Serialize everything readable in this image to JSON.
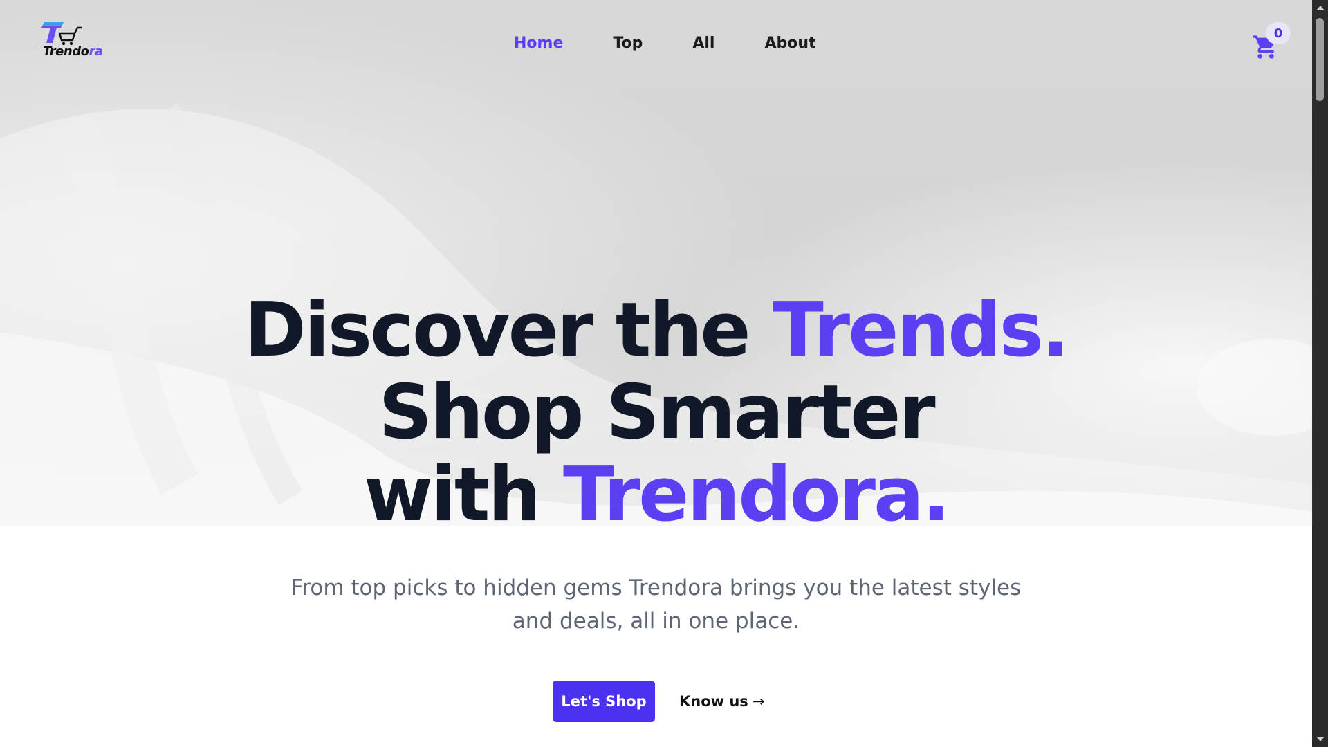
{
  "brand": {
    "logo_text": "Trendo",
    "logo_accent_text": "ra",
    "accent_color": "#5b3ff2",
    "text_color": "#111827"
  },
  "nav": {
    "items": [
      {
        "label": "Home",
        "active": true
      },
      {
        "label": "Top",
        "active": false
      },
      {
        "label": "All",
        "active": false
      },
      {
        "label": "About",
        "active": false
      }
    ]
  },
  "cart": {
    "icon": "cart-icon",
    "count": "0"
  },
  "hero": {
    "line1_text": "Discover the ",
    "line1_accent": "Trends.",
    "line2_text": "Shop Smarter",
    "line3_text": "with ",
    "line3_accent": "Trendora."
  },
  "subtitle": {
    "text": "From top picks to hidden gems Trendora brings you the latest styles and deals, all in one place."
  },
  "actions": {
    "primary_label": "Let's Shop",
    "secondary_label": "Know us",
    "secondary_arrow": "→"
  }
}
